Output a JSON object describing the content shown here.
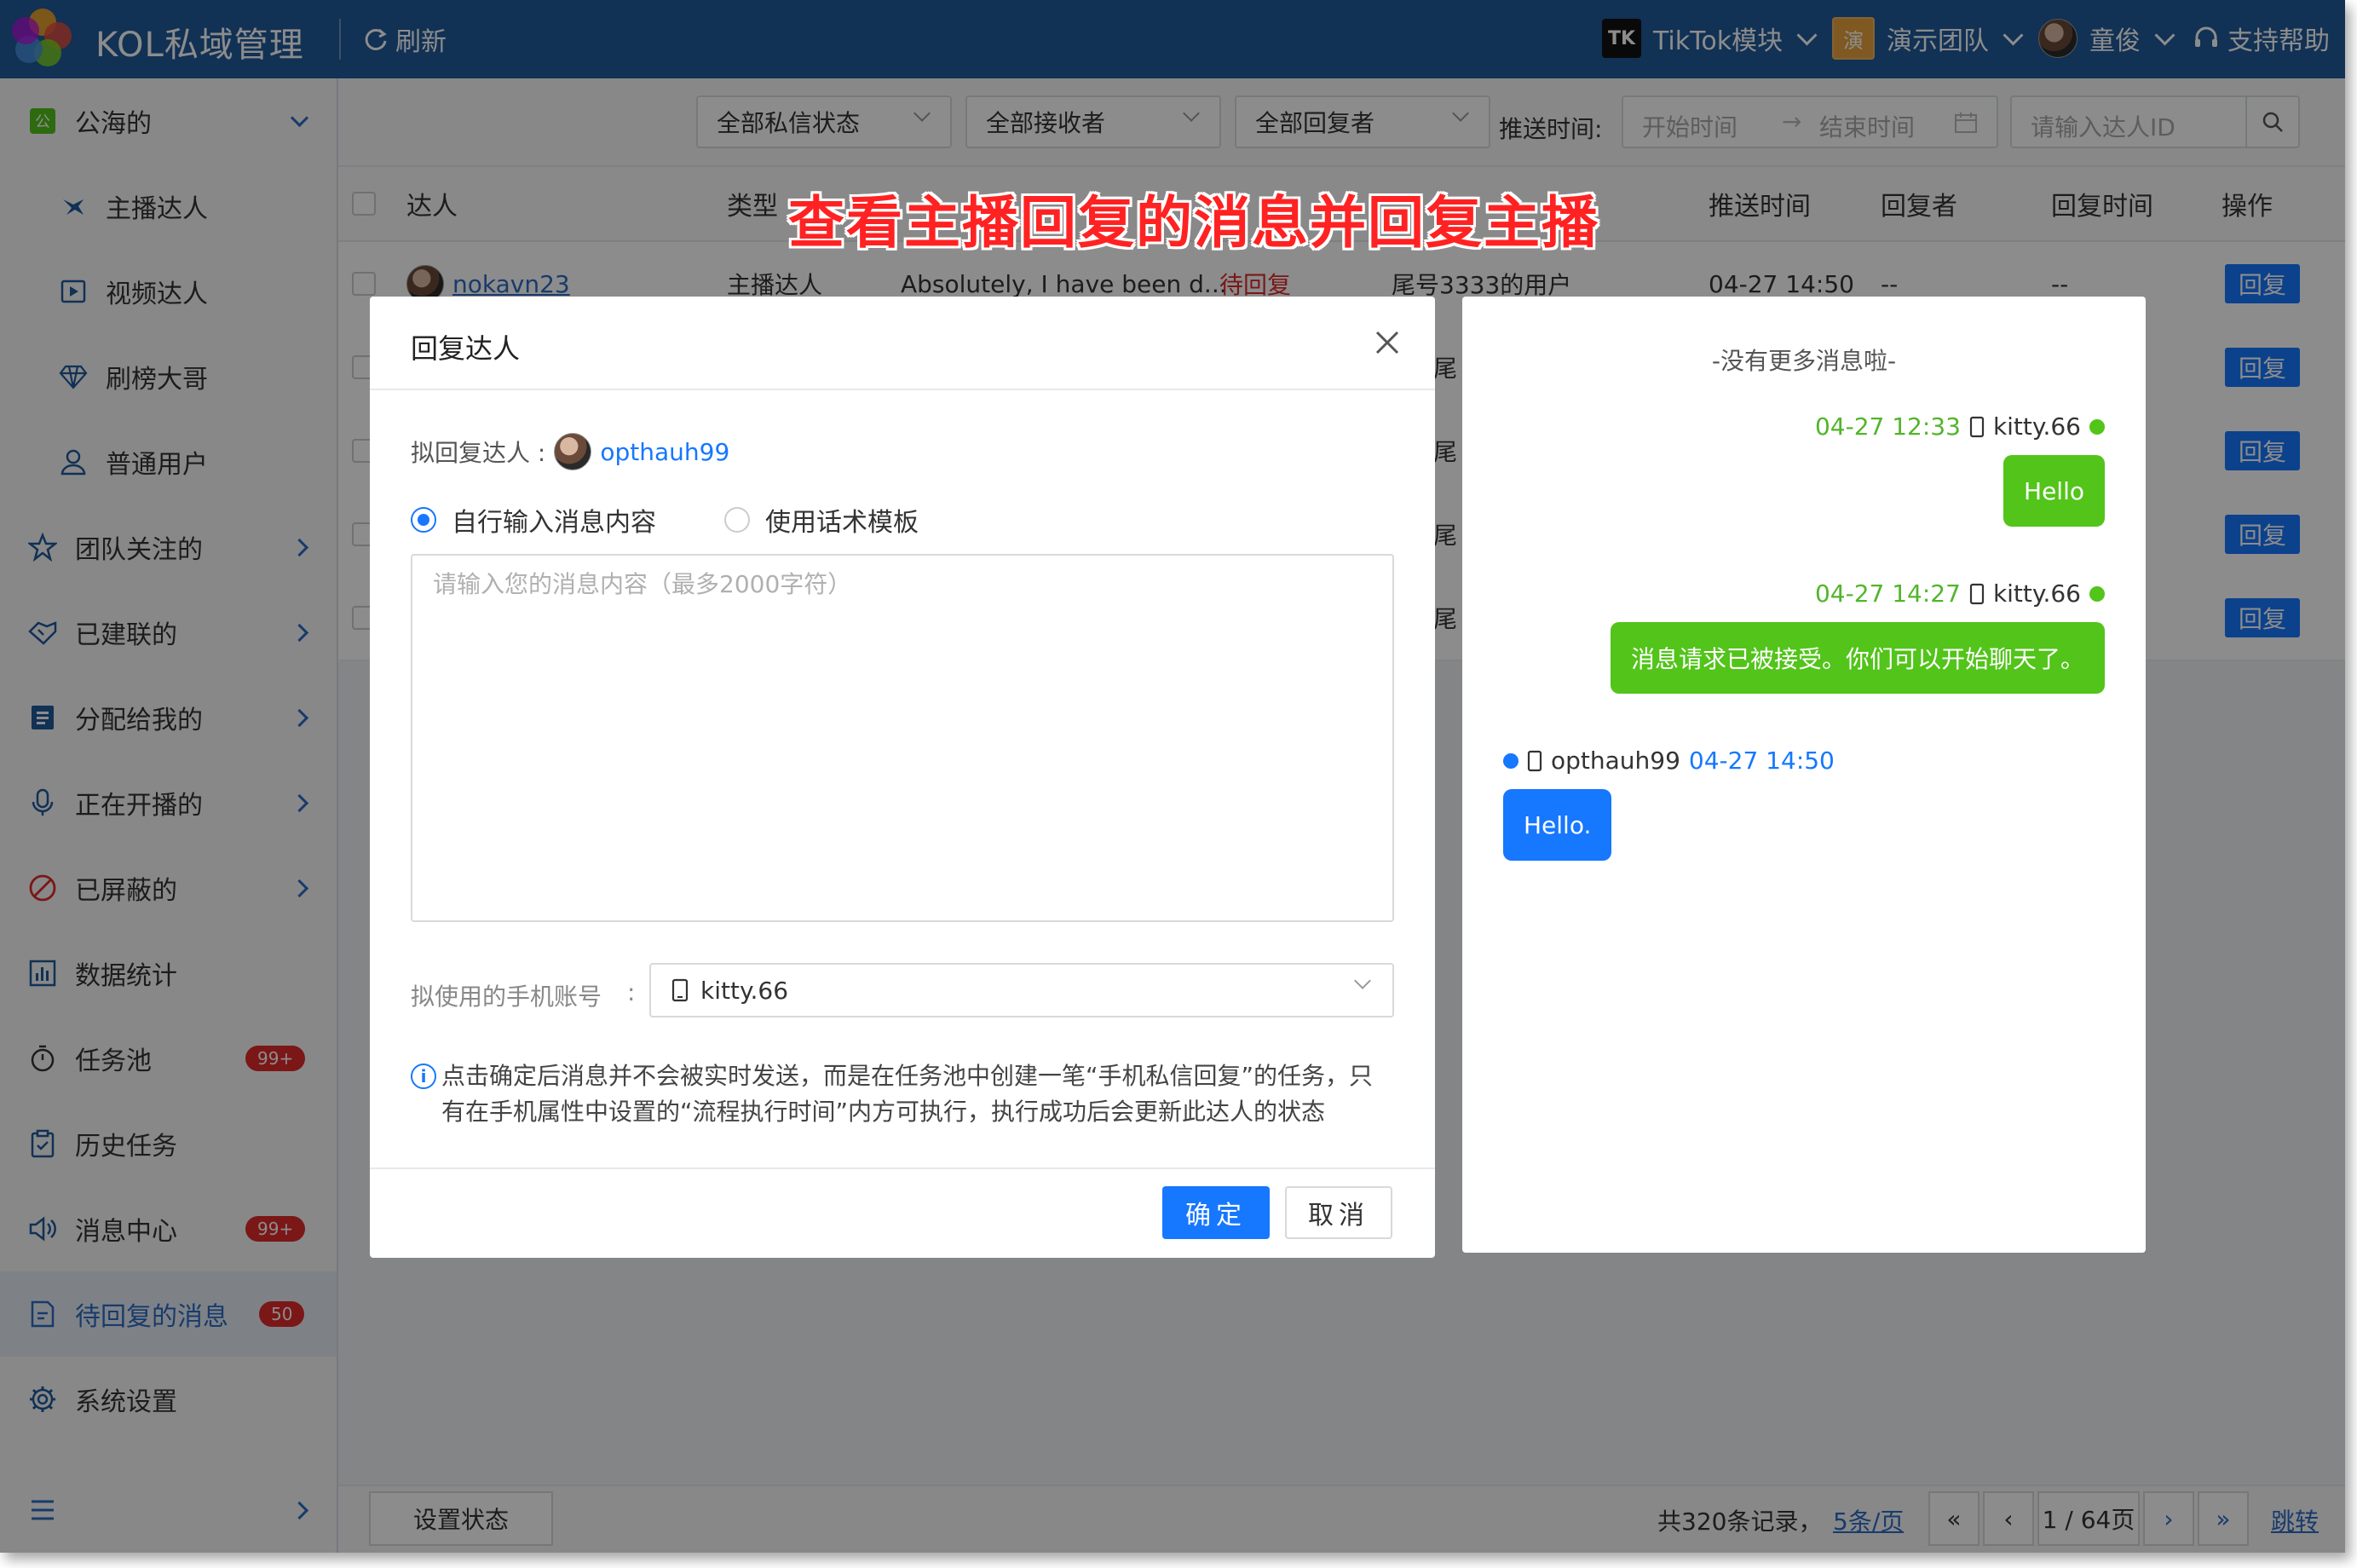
{
  "app": {
    "title": "KOL私域管理",
    "refresh_label": "刷新",
    "module": "TikTok模块",
    "module_icon_text": "TK",
    "team": "演示团队",
    "team_icon_text": "演",
    "user": "童俊",
    "help": "支持帮助"
  },
  "sidebar": {
    "group": "公海的",
    "sub_items": [
      {
        "label": "主播达人",
        "icon": "anchor-icon"
      },
      {
        "label": "视频达人",
        "icon": "video-icon"
      },
      {
        "label": "刷榜大哥",
        "icon": "diamond-icon"
      },
      {
        "label": "普通用户",
        "icon": "user-icon"
      }
    ],
    "items": [
      {
        "label": "团队关注的",
        "icon": "star-icon"
      },
      {
        "label": "已建联的",
        "icon": "handshake-icon"
      },
      {
        "label": "分配给我的",
        "icon": "assigned-icon"
      },
      {
        "label": "正在开播的",
        "icon": "mic-icon"
      },
      {
        "label": "已屏蔽的",
        "icon": "block-icon"
      },
      {
        "label": "数据统计",
        "icon": "chart-icon"
      },
      {
        "label": "任务池",
        "icon": "timer-icon",
        "badge": "99+"
      },
      {
        "label": "历史任务",
        "icon": "clipboard-icon"
      },
      {
        "label": "消息中心",
        "icon": "speaker-icon",
        "badge": "99+"
      },
      {
        "label": "待回复的消息",
        "icon": "reply-doc-icon",
        "badge": "50"
      },
      {
        "label": "系统设置",
        "icon": "gear-icon"
      }
    ]
  },
  "filters": {
    "dm_status": "全部私信状态",
    "receiver": "全部接收者",
    "replier": "全部回复者",
    "push_time_label": "推送时间:",
    "start_placeholder": "开始时间",
    "end_placeholder": "结束时间",
    "search_placeholder": "请输入达人ID"
  },
  "table": {
    "headers": {
      "influencer": "达人",
      "type": "类型",
      "push_time": "推送时间",
      "replier": "回复者",
      "reply_time": "回复时间",
      "action": "操作"
    },
    "first_row": {
      "influencer": "nokavn23",
      "type": "主播达人",
      "message": "Absolutely, I have been d...",
      "status": "待回复",
      "user": "尾号3333的用户",
      "push_time": "04-27 14:50",
      "replier": "--",
      "reply_time": "--"
    },
    "partial_user": "尾",
    "reply_label": "回复"
  },
  "footer": {
    "set_status": "设置状态",
    "total": "共320条记录，",
    "page_size": "5条/页",
    "page": "1 / 64页",
    "jump": "跳转"
  },
  "banner": "查看主播回复的消息并回复主播",
  "modal": {
    "title": "回复达人",
    "target_label": "拟回复达人 :",
    "target_name": "opthauh99",
    "radio_custom": "自行输入消息内容",
    "radio_template": "使用话术模板",
    "textarea_placeholder": "请输入您的消息内容（最多2000字符）",
    "phone_label": "拟使用的手机账号",
    "phone_colon": ":",
    "phone_value": "kitty.66",
    "notice_line1": "点击确定后消息并不会被实时发送，而是在任务池中创建一笔“手机私信回复”的任务，只",
    "notice_line2": "有在手机属性中设置的“流程执行时间”内方可执行，执行成功后会更新此达人的状态",
    "ok": "确定",
    "cancel": "取消"
  },
  "chat": {
    "no_more": "-没有更多消息啦-",
    "messages": [
      {
        "time": "04-27 12:33",
        "account": "kitty.66",
        "text": "Hello",
        "side": "right"
      },
      {
        "time": "04-27 14:27",
        "account": "kitty.66",
        "text": "消息请求已被接受。你们可以开始聊天了。",
        "side": "right"
      },
      {
        "time": "04-27 14:50",
        "account": "opthauh99",
        "text": "Hello.",
        "side": "left"
      }
    ]
  },
  "colors": {
    "primary": "#1677ff",
    "topbar": "#1f5a9b",
    "green": "#52c41a",
    "badge": "#e02a2a",
    "banner": "#ff2222"
  }
}
